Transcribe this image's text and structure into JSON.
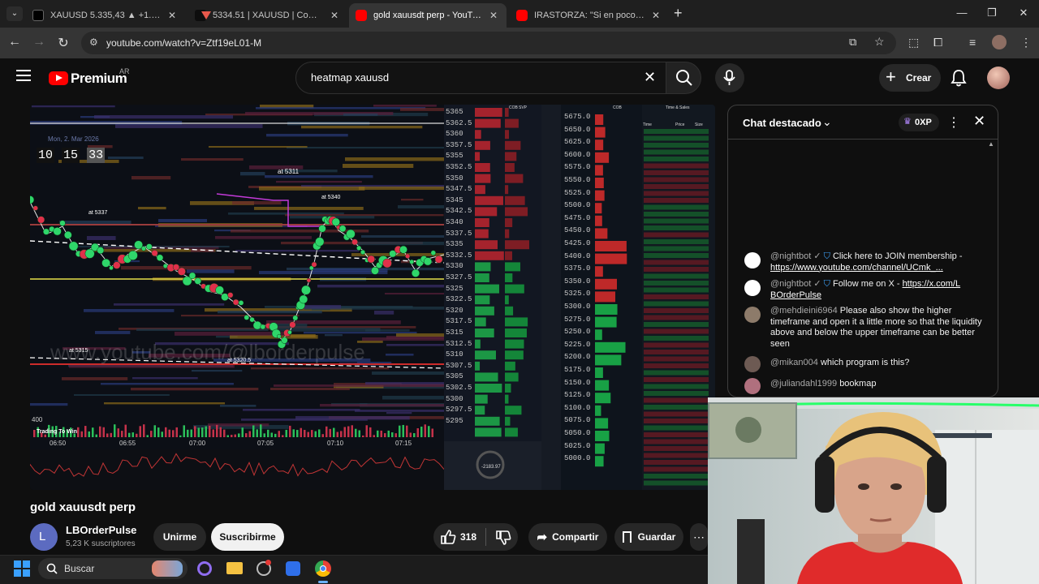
{
  "browser": {
    "tabs": [
      {
        "title": "XAUUSD 5.335,43 ▲ +1.09% Ent",
        "color": "#1a1a1a"
      },
      {
        "title": "5334.51 | XAUUSD | Comercio v",
        "color": "#1a1a1a"
      },
      {
        "title": "gold xauusdt perp - YouTube",
        "color": "#ff0000"
      },
      {
        "title": "IRASTORZA: \"Si en pocos días n",
        "color": "#ff0000"
      }
    ],
    "url": "youtube.com/watch?v=Ztf19eL01-M"
  },
  "youtube": {
    "logo_text": "Premium",
    "region": "AR",
    "search_value": "heatmap xauusd",
    "create_label": "Crear"
  },
  "video": {
    "watermark": "www.youtube.com/@lborderpulse",
    "clock": {
      "h": "10",
      "m": "15",
      "s": "33"
    },
    "date_text": "Mon, 2. Mar 2026",
    "price_tags": [
      "at 5311",
      "at 5337",
      "at 5340",
      "at 5320.5",
      "at 5315"
    ],
    "time_labels": [
      "06:50",
      "06:55",
      "07:00",
      "07:05",
      "07:10",
      "07:15"
    ],
    "ladder_left": [
      "5365",
      "5362.5",
      "5360",
      "5357.5",
      "5355",
      "5352.5",
      "5350",
      "5347.5",
      "5345",
      "5342.5",
      "5340",
      "5337.5",
      "5335",
      "5332.5",
      "5330",
      "5327.5",
      "5325",
      "5322.5",
      "5320",
      "5317.5",
      "5315",
      "5312.5",
      "5310",
      "5307.5",
      "5305",
      "5302.5",
      "5300",
      "5297.5",
      "5295"
    ],
    "ladder_right": [
      "5675.0",
      "5650.0",
      "5625.0",
      "5600.0",
      "5575.0",
      "5550.0",
      "5525.0",
      "5500.0",
      "5475.0",
      "5450.0",
      "5425.0",
      "5400.0",
      "5375.0",
      "5350.0",
      "5325.0",
      "5300.0",
      "5275.0",
      "5250.0",
      "5225.0",
      "5200.0",
      "5175.0",
      "5150.0",
      "5125.0",
      "5100.0",
      "5075.0",
      "5050.0",
      "5025.0",
      "5000.0"
    ],
    "ts_headers": [
      "Time",
      "Price",
      "Size"
    ],
    "panel_labels": {
      "cob": "COB",
      "svp": "SVP",
      "ts": "Time & Sales"
    },
    "left_footer": "Trading To Win",
    "axis_400": "400",
    "gauge_value": "-2183.97"
  },
  "title": "gold xauusdt perp",
  "channel": {
    "initial": "L",
    "name": "LBOrderPulse",
    "subs": "5,23 K suscriptores",
    "join_label": "Unirme",
    "subscribe_label": "Suscribirme"
  },
  "actions": {
    "likes": "318",
    "share_label": "Compartir",
    "save_label": "Guardar"
  },
  "chat": {
    "header": "Chat destacado",
    "points": "0XP",
    "messages": [
      {
        "author": "@nightbot ✓",
        "text": "Click here to JOIN membership -",
        "link": "https://www.youtube.com/channel/UCmk_..."
      },
      {
        "author": "@nightbot ✓",
        "text": "Follow me on X -",
        "link": "https://x.com/L BOrderPulse"
      },
      {
        "author": "@mehdieini6964",
        "text": "Please also show the higher timeframe and open it a little more so that the liquidity above and below the upper timeframe can be better seen"
      },
      {
        "author": "@mikan004",
        "text": "which program is this?"
      },
      {
        "author": "@juliandahl1999",
        "text": "bookmap"
      }
    ]
  },
  "taskbar": {
    "search_placeholder": "Buscar"
  }
}
